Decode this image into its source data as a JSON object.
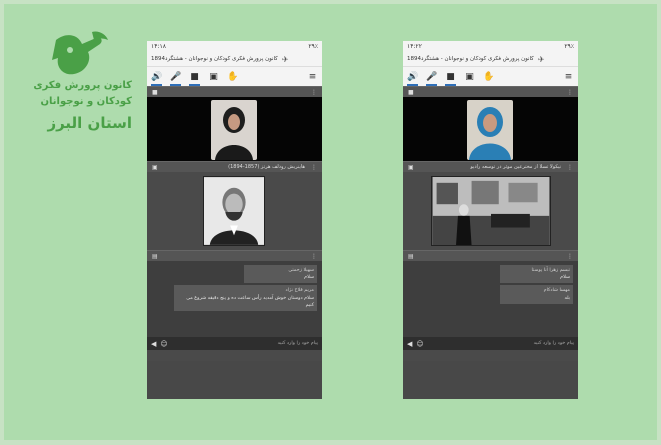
{
  "logo": {
    "line1": "کانون پرورش فکری",
    "line2": "کودکان و نوجوانان",
    "line3": "استان البرز",
    "brand_color": "#4aa047"
  },
  "phones": [
    {
      "status_time": "۱۴:۱۸",
      "status_right": "۲۹٪",
      "title": "کانون پرورش فکری کودکان و نوجوانان - هشتگرد1894",
      "video_label": "",
      "share_title": "هاینریش رودلف هرتز (1857-1894)",
      "chat": [
        {
          "who": "سهیلا زحمتی",
          "text": "سلام"
        },
        {
          "who": "مریم فلاح نژاد",
          "text": "سلام دوستان خوش آمدید رأس ساعت ده و پنج دقیقه شروع می کنیم"
        }
      ],
      "input_placeholder": "پیام خود را وارد کنید"
    },
    {
      "status_time": "۱۴:۲۲",
      "status_right": "۲۹٪",
      "title": "کانون پرورش فکری کودکان و نوجوانان - هشتگرد1894",
      "video_label": "",
      "share_title": "نیکولا تسلا از مخترعین موثر در توسعه رادیو",
      "chat": [
        {
          "who": "تبسم زهرا آنا پوستا",
          "text": "سلام"
        },
        {
          "who": "مهسا شادکام",
          "text": "بله"
        }
      ],
      "input_placeholder": "پیام خود را وارد کنید"
    }
  ]
}
